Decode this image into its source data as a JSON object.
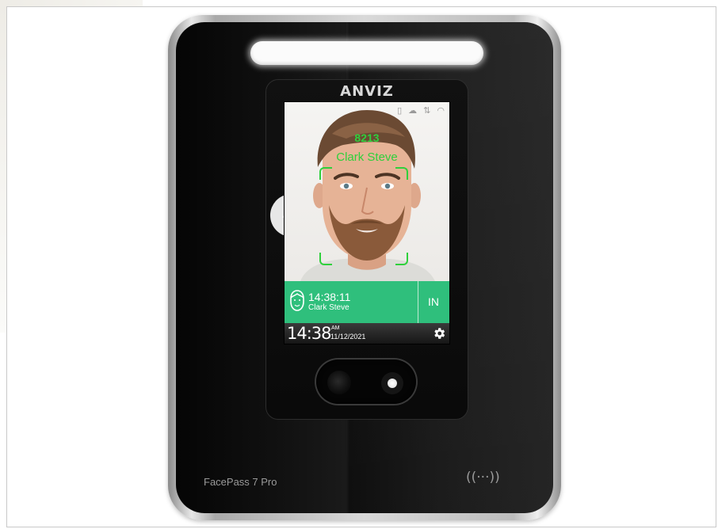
{
  "device": {
    "brand": "ANVIZ",
    "model": "FacePass 7 Pro",
    "nfc_symbol": "((···))"
  },
  "screen": {
    "status_icons": [
      "usb-icon",
      "cloud-icon",
      "network-icon",
      "wifi-icon"
    ],
    "face_overlay": {
      "id": "8213",
      "name": "Clark Steve"
    },
    "result": {
      "time": "14:38:11",
      "name": "Clark Steve",
      "status": "IN"
    },
    "clock": {
      "time": "14:38",
      "ampm": "AM",
      "date": "11/12/2021"
    }
  },
  "colors": {
    "accent_green": "#2fd03c",
    "result_bar": "#2fbf7c"
  }
}
